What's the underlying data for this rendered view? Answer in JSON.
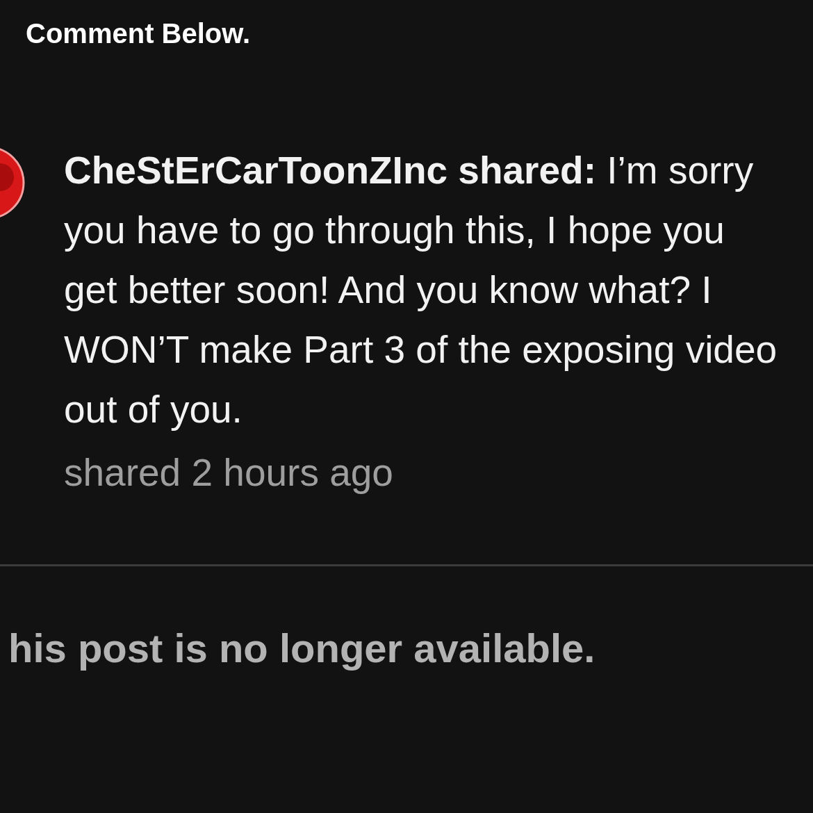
{
  "header": {
    "title": "Comment Below."
  },
  "comment": {
    "text": "**CheStErCarToonZInc shared:** I’m sorry you have to go through this, I hope you get better soon! And you know what? I WON’T make Part 3 of the exposing video out of you.",
    "timestamp": "shared 2 hours ago"
  },
  "notice": {
    "text": "his post is no longer available."
  }
}
